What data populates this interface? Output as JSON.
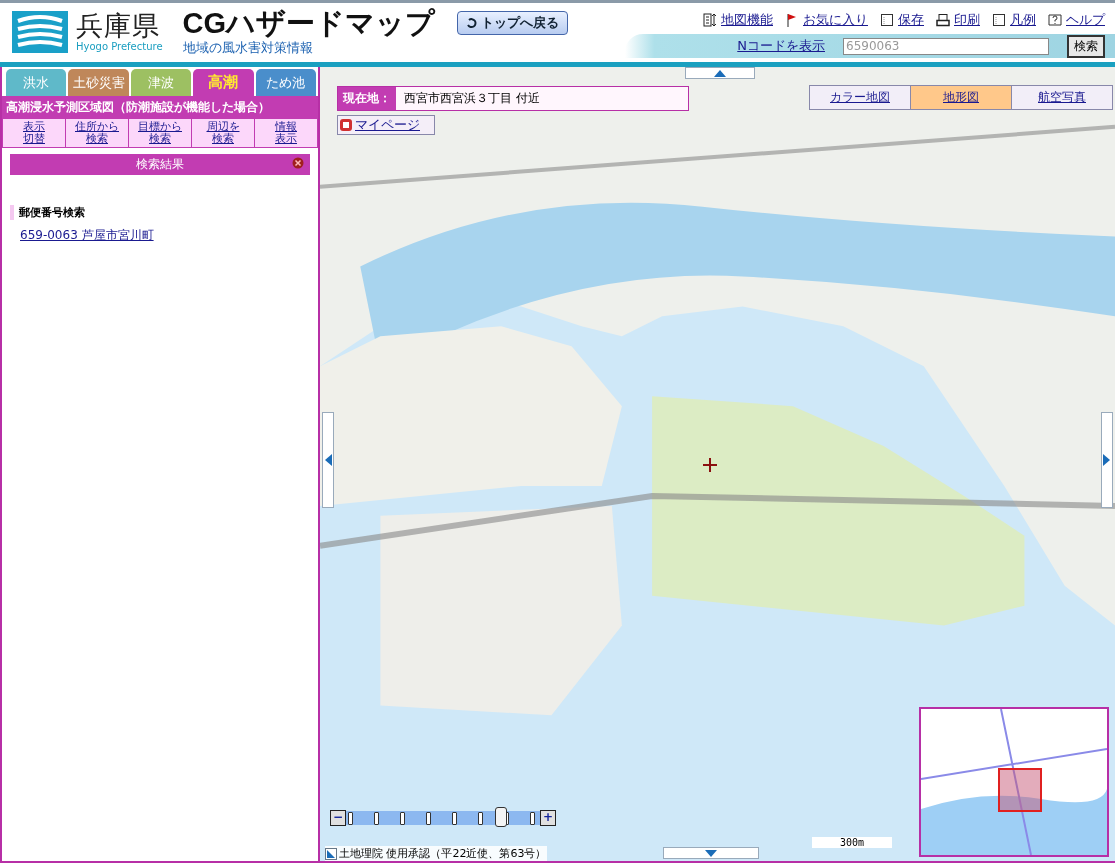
{
  "header": {
    "prefecture": "兵庫県",
    "prefecture_en": "Hyogo Prefecture",
    "title": "CGハザードマップ",
    "subtitle": "地域の風水害対策情報",
    "top_button": "トップへ戻る"
  },
  "menu": [
    {
      "label": "地図機能",
      "kind": "map"
    },
    {
      "label": "お気に入り",
      "kind": "flag"
    },
    {
      "label": "保存",
      "kind": "doc"
    },
    {
      "label": "印刷",
      "kind": "print"
    },
    {
      "label": "凡例",
      "kind": "doc"
    },
    {
      "label": "ヘルプ",
      "kind": "help"
    }
  ],
  "ncode": {
    "link": "Nコードを表示",
    "value": "6590063",
    "button": "検索"
  },
  "tabs": [
    {
      "label": "洪水",
      "selected": false,
      "color": "#5fb9c9"
    },
    {
      "label": "土砂災害",
      "selected": false,
      "color": "#bf875a"
    },
    {
      "label": "津波",
      "selected": false,
      "color": "#9dc062"
    },
    {
      "label": "高潮",
      "selected": true,
      "color": "#c23cb2"
    },
    {
      "label": "ため池",
      "selected": false,
      "color": "#4a8ecb"
    }
  ],
  "panel": {
    "title": "高潮浸水予測区域図（防潮施設が機能した場合）",
    "actions": [
      {
        "lines": [
          "表示",
          "切替"
        ]
      },
      {
        "lines": [
          "住所から",
          "検索"
        ]
      },
      {
        "lines": [
          "目標から",
          "検索"
        ]
      },
      {
        "lines": [
          "周辺を",
          "検索"
        ]
      },
      {
        "lines": [
          "情報",
          "表示"
        ]
      }
    ],
    "results": {
      "title": "検索結果",
      "section": "郵便番号検索",
      "items": [
        "659-0063 芦屋市宮川町"
      ]
    }
  },
  "map": {
    "location_label": "現在地：",
    "location": "西宮市西宮浜３丁目 付近",
    "mypage": "マイページ",
    "map_types": [
      {
        "label": "カラー地図",
        "selected": false
      },
      {
        "label": "地形図",
        "selected": true
      },
      {
        "label": "航空写真",
        "selected": false
      }
    ],
    "zoom": {
      "minus": "−",
      "plus": "+",
      "level": 0.8
    },
    "attribution": "土地理院 使用承認（平22近使、第63号）",
    "scale": "300m"
  }
}
